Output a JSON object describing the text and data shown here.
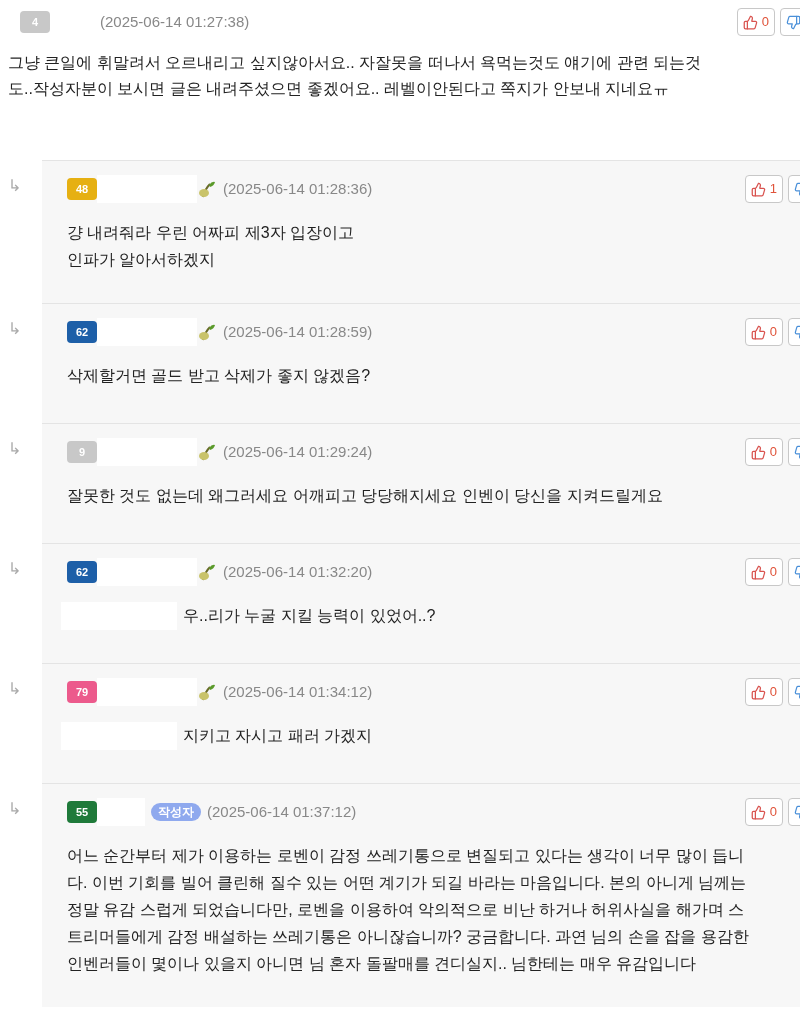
{
  "comment": {
    "badge": {
      "number": "4",
      "color": "#c8c8c8"
    },
    "date": "(2025-06-14 01:27:38)",
    "likes": "0",
    "body": "그냥 큰일에 휘말려서 오르내리고 싶지않아서요.. 자잘못을 떠나서 욕먹는것도 얘기에 관련 되는것도..작성자분이 보시면 글은 내려주셨으면 좋겠어요.. 레벨이안된다고 쪽지가 안보내 지네요ㅠ"
  },
  "replies": [
    {
      "arrow": "↳",
      "badge": {
        "number": "48",
        "color": "#e6b012"
      },
      "sprout": true,
      "date": "(2025-06-14 01:28:36)",
      "likes": "1",
      "mention_redacted": false,
      "body": "걍 내려줘라 우린 어짜피 제3자 입장이고\n인파가 알아서하겠지"
    },
    {
      "arrow": "↳",
      "badge": {
        "number": "62",
        "color": "#1d5fa8"
      },
      "sprout": true,
      "date": "(2025-06-14 01:28:59)",
      "likes": "0",
      "mention_redacted": false,
      "body": "삭제할거면 골드 받고 삭제가 좋지 않겠음?"
    },
    {
      "arrow": "↳",
      "badge": {
        "number": "9",
        "color": "#c8c8c8"
      },
      "sprout": true,
      "date": "(2025-06-14 01:29:24)",
      "likes": "0",
      "mention_redacted": false,
      "body": "잘못한 것도 없는데 왜그러세요 어깨피고 당당해지세요 인벤이 당신을 지켜드릴게요"
    },
    {
      "arrow": "↳",
      "badge": {
        "number": "62",
        "color": "#1d5fa8"
      },
      "sprout": true,
      "date": "(2025-06-14 01:32:20)",
      "likes": "0",
      "mention_redacted": true,
      "body": "우..리가 누굴 지킬 능력이 있었어..?"
    },
    {
      "arrow": "↳",
      "badge": {
        "number": "79",
        "color": "#ec5a8c"
      },
      "sprout": true,
      "date": "(2025-06-14 01:34:12)",
      "likes": "0",
      "mention_redacted": true,
      "body": "지키고 자시고 패러 가겠지"
    },
    {
      "arrow": "↳",
      "badge": {
        "number": "55",
        "color": "#1f7a3a"
      },
      "sprout": false,
      "author_tag": "작성자",
      "date": "(2025-06-14 01:37:12)",
      "likes": "0",
      "mention_redacted": false,
      "body": "어느 순간부터 제가 이용하는 로벤이 감정 쓰레기통으로 변질되고 있다는 생각이 너무 많이 듭니다. 이번 기회를 빌어 클린해 질수 있는 어떤 계기가 되길 바라는 마음입니다. 본의 아니게 님께는 정말 유감 스럽게 되었습니다만, 로벤을 이용하여 악의적으로 비난 하거나 허위사실을 해가며 스트리머들에게 감정 배설하는 쓰레기통은 아니잖습니까? 궁금합니다. 과연 님의 손을 잡을 용감한 인벤러들이 몇이나 있을지 아니면 님 혼자 돌팔매를 견디실지.. 님한테는 매우 유감입니다"
    }
  ]
}
